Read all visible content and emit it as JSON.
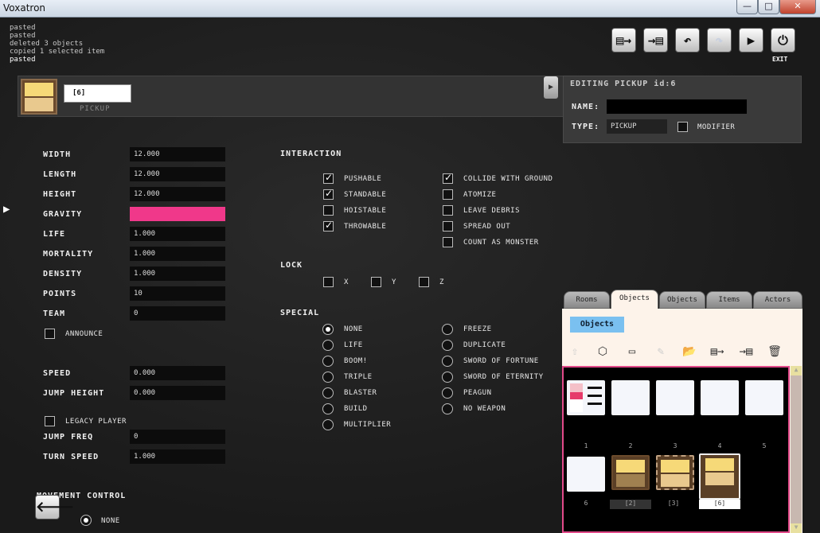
{
  "window": {
    "title": "Voxatron",
    "min": "—",
    "max": "□",
    "close": "✕"
  },
  "log": [
    "pasted",
    "pasted",
    "deleted 3 objects",
    "copied 1 selected item",
    "pasted"
  ],
  "toolbar": {
    "exit_label": "EXIT"
  },
  "object": {
    "name_value": "[6]",
    "type_caption": "PICKUP"
  },
  "editing": {
    "title": "EDITING PICKUP id:6",
    "name_label": "NAME:",
    "name_value": "",
    "type_label": "TYPE:",
    "type_value": "PICKUP",
    "modifier_label": "MODIFIER"
  },
  "props": [
    {
      "label": "WIDTH",
      "value": "12.000"
    },
    {
      "label": "LENGTH",
      "value": "12.000"
    },
    {
      "label": "HEIGHT",
      "value": "12.000"
    },
    {
      "label": "GRAVITY",
      "value": ""
    },
    {
      "label": "LIFE",
      "value": "1.000"
    },
    {
      "label": "MORTALITY",
      "value": "1.000"
    },
    {
      "label": "DENSITY",
      "value": "1.000"
    },
    {
      "label": "POINTS",
      "value": "10"
    },
    {
      "label": "TEAM",
      "value": "0"
    }
  ],
  "announce_label": "ANNOUNCE",
  "props2": [
    {
      "label": "SPEED",
      "value": "0.000"
    },
    {
      "label": "JUMP HEIGHT",
      "value": "0.000"
    }
  ],
  "legacy_label": "LEGACY PLAYER",
  "props3": [
    {
      "label": "JUMP FREQ",
      "value": "0"
    },
    {
      "label": "TURN SPEED",
      "value": "1.000"
    }
  ],
  "movement": {
    "title": "MOVEMENT CONTROL",
    "none_label": "NONE"
  },
  "gravity_color": "#f0388a",
  "interaction": {
    "title": "INTERACTION",
    "left": [
      {
        "label": "PUSHABLE",
        "checked": true
      },
      {
        "label": "STANDABLE",
        "checked": true
      },
      {
        "label": "HOISTABLE",
        "checked": false
      },
      {
        "label": "THROWABLE",
        "checked": true
      }
    ],
    "right": [
      {
        "label": "COLLIDE WITH GROUND",
        "checked": true
      },
      {
        "label": "ATOMIZE",
        "checked": false
      },
      {
        "label": "LEAVE DEBRIS",
        "checked": false
      },
      {
        "label": "SPREAD OUT",
        "checked": false
      },
      {
        "label": "COUNT AS MONSTER",
        "checked": false
      }
    ]
  },
  "lock": {
    "title": "LOCK",
    "x": "X",
    "y": "Y",
    "z": "Z"
  },
  "special": {
    "title": "SPECIAL",
    "left": [
      "NONE",
      "LIFE",
      "BOOM!",
      "TRIPLE",
      "BLASTER",
      "BUILD",
      "MULTIPLIER"
    ],
    "right": [
      "FREEZE",
      "DUPLICATE",
      "SWORD OF FORTUNE",
      "SWORD OF ETERNITY",
      "PEAGUN",
      "NO WEAPON"
    ],
    "selected": "NONE"
  },
  "tabs": [
    "Rooms",
    "Objects",
    "Objects",
    "Items",
    "Actors"
  ],
  "browser": {
    "section_label": "Objects",
    "numbers": [
      "1",
      "2",
      "3",
      "4",
      "5",
      "6"
    ],
    "captions": [
      "[2]",
      "[3]",
      "[6]"
    ]
  }
}
